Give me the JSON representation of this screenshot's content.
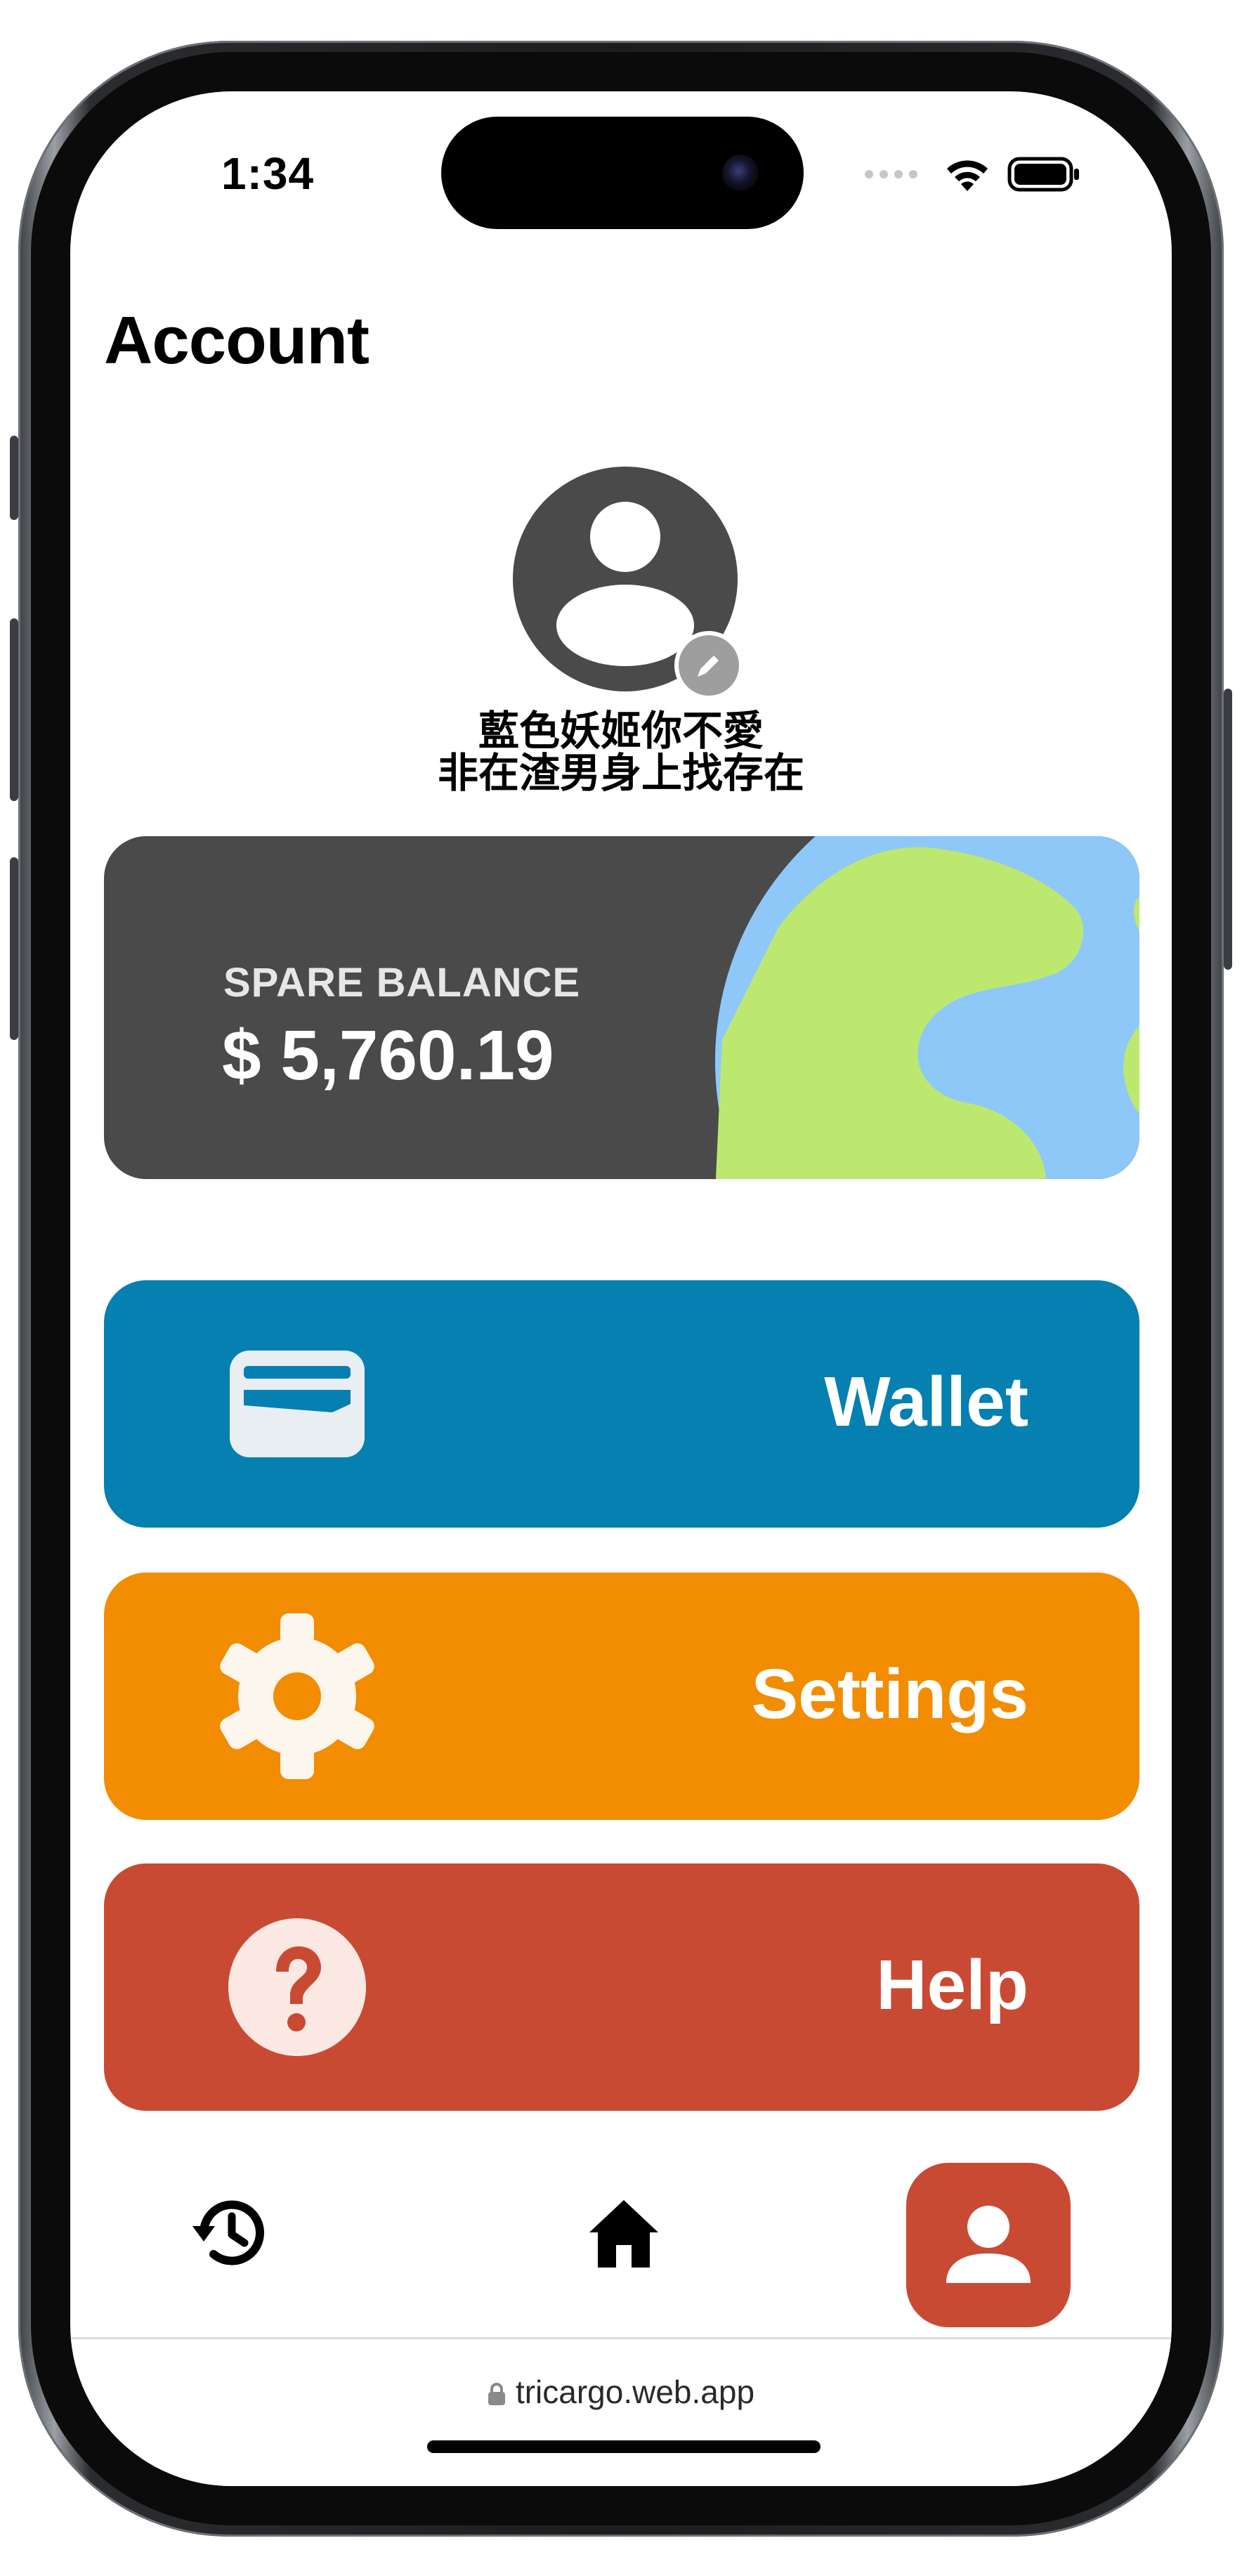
{
  "status_bar": {
    "time": "1:34"
  },
  "header": {
    "title": "Account"
  },
  "profile": {
    "name_line1": "藍色妖姬你不愛",
    "name_line2": "非在渣男身上找存在"
  },
  "balance": {
    "label": "SPARE BALANCE",
    "value": "$ 5,760.19"
  },
  "menu": [
    {
      "label": "Wallet",
      "icon": "wallet-icon",
      "color": "#0580b0"
    },
    {
      "label": "Settings",
      "icon": "gear-icon",
      "color": "#f28c00"
    },
    {
      "label": "Help",
      "icon": "help-icon",
      "color": "#c94a33"
    }
  ],
  "nav": {
    "items": [
      "history-icon",
      "home-icon",
      "account-icon"
    ],
    "active": "account-icon"
  },
  "browser": {
    "url": "tricargo.web.app"
  }
}
